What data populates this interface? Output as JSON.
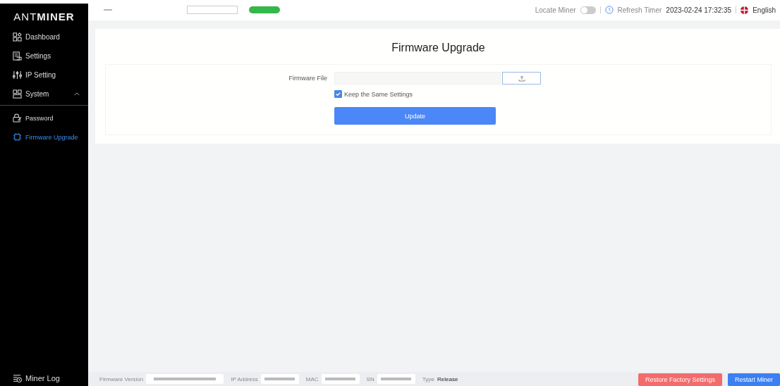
{
  "logo": {
    "text_light": "ANT",
    "text_bold": "MINER"
  },
  "sidebar": {
    "items": [
      {
        "label": "Dashboard",
        "kind": "grid",
        "selected": false
      },
      {
        "label": "Settings",
        "kind": "doc",
        "selected": false
      },
      {
        "label": "IP Setting",
        "kind": "sliders",
        "selected": false
      },
      {
        "label": "System",
        "kind": "system",
        "selected": false,
        "expanded": true,
        "children": [
          {
            "label": "Password",
            "kind": "lock",
            "selected": false
          },
          {
            "label": "Firmware Upgrade",
            "kind": "chip",
            "selected": true
          }
        ]
      }
    ],
    "footer_item": {
      "label": "Miner Log"
    }
  },
  "header": {
    "locate_label": "Locate Miner",
    "locate_on": false,
    "refresh_label": "Refresh Timer",
    "timestamp": "2023-02-24 17:32:35",
    "language": "English"
  },
  "page": {
    "title": "Firmware Upgrade",
    "file_label": "Firmware File",
    "keep_settings": {
      "label": "Keep the Same Settings",
      "checked": true
    },
    "update_button": "Update"
  },
  "status_bar": {
    "fields": [
      {
        "label": "Firmware Version",
        "kind": "hidden"
      },
      {
        "label": "IP Address",
        "kind": "hidden"
      },
      {
        "label": "MAC",
        "kind": "hidden"
      },
      {
        "label": "SN",
        "kind": "hidden"
      },
      {
        "label": "Type",
        "kind": "text",
        "value": "Release"
      }
    ],
    "buttons": [
      {
        "label": "Restore Factory Settings",
        "kind": "danger"
      },
      {
        "label": "Restart Miner",
        "kind": "primary"
      }
    ]
  }
}
